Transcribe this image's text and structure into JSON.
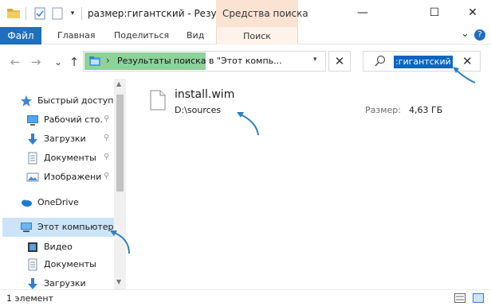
{
  "window": {
    "title": "размер:гигантский - Резуль",
    "contextual_tab_group": "Средства поиска",
    "minimize_glyph": "—",
    "maximize_glyph": "☐",
    "close_glyph": "✕"
  },
  "ribbon": {
    "file_tab": "Файл",
    "tabs": [
      "Главная",
      "Поделиться",
      "Вид"
    ],
    "search_tab": "Поиск",
    "collapse_glyph": "⌄",
    "help_glyph": "?"
  },
  "nav": {
    "back_glyph": "←",
    "forward_glyph": "→",
    "recent_glyph": "⌄",
    "up_glyph": "↑",
    "address_chevron": "›",
    "address_highlight": "Результаты поиска",
    "address_rest": " в \"Этот компь...",
    "address_dropdown": "▾",
    "clear_glyph": "✕",
    "search_value": ":гигантский",
    "search_clear_glyph": "✕"
  },
  "sidebar": {
    "items": [
      {
        "label": "Быстрый доступ",
        "icon": "star-icon",
        "pinned": false
      },
      {
        "label": "Рабочий сто.",
        "icon": "desktop-icon",
        "pinned": true
      },
      {
        "label": "Загрузки",
        "icon": "download-icon",
        "pinned": true
      },
      {
        "label": "Документы",
        "icon": "document-icon",
        "pinned": true
      },
      {
        "label": "Изображени",
        "icon": "picture-icon",
        "pinned": true
      },
      {
        "label": "OneDrive",
        "icon": "cloud-icon",
        "pinned": false
      },
      {
        "label": "Этот компьютер",
        "icon": "computer-icon",
        "pinned": false,
        "selected": true
      },
      {
        "label": "Видео",
        "icon": "video-icon",
        "pinned": false
      },
      {
        "label": "Документы",
        "icon": "document-icon",
        "pinned": false
      },
      {
        "label": "Загрузки",
        "icon": "download-icon",
        "pinned": false
      }
    ],
    "pin_glyph": "📌"
  },
  "results": [
    {
      "name": "install.wim",
      "path": "D:\\sources",
      "size_label": "Размер:",
      "size_value": "4,63 ГБ"
    }
  ],
  "status": {
    "count_text": "1 элемент"
  },
  "colors": {
    "accent": "#1f6fbf",
    "address_highlight": "#8ed29a",
    "context_tab": "#fbe3d3",
    "selection": "#cce4f7",
    "search_selection": "#0a66c2",
    "annotation_arrow": "#2b7fc1"
  }
}
